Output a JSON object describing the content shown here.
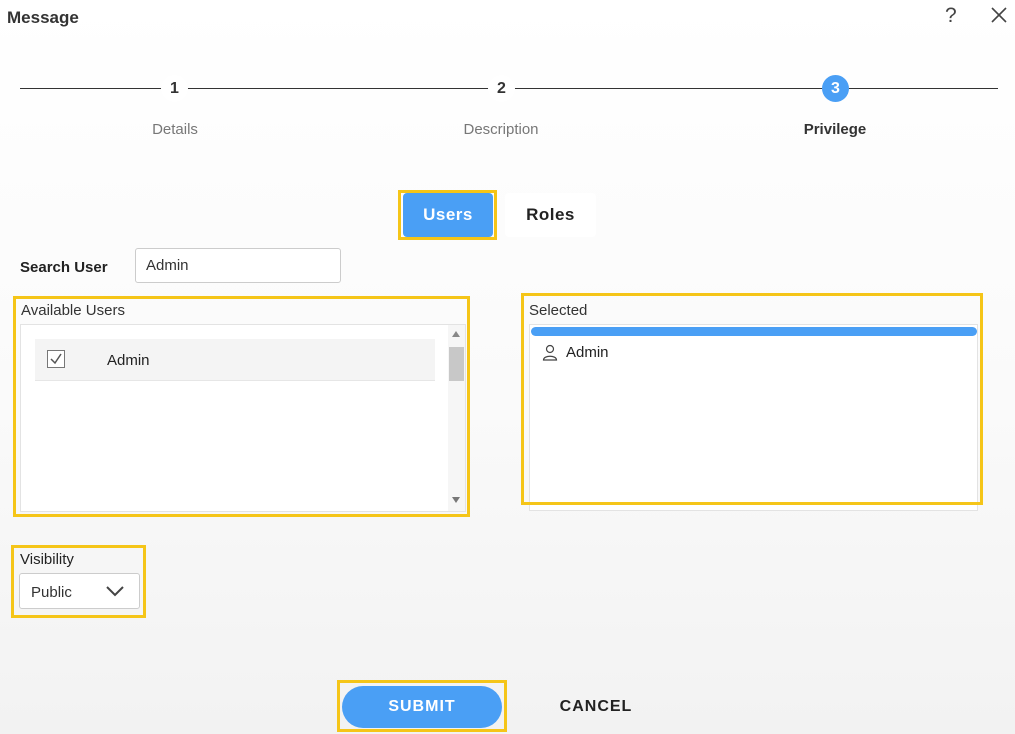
{
  "window": {
    "title": "Message"
  },
  "steps": [
    {
      "number": "1",
      "label": "Details"
    },
    {
      "number": "2",
      "label": "Description"
    },
    {
      "number": "3",
      "label": "Privilege"
    }
  ],
  "tabs": {
    "users": "Users",
    "roles": "Roles"
  },
  "search": {
    "label": "Search User",
    "value": "Admin"
  },
  "available": {
    "title": "Available Users",
    "items": [
      {
        "label": "Admin",
        "checked": true
      }
    ]
  },
  "selected": {
    "title": "Selected",
    "items": [
      {
        "label": "Admin"
      }
    ]
  },
  "visibility": {
    "label": "Visibility",
    "value": "Public"
  },
  "actions": {
    "submit": "SUBMIT",
    "cancel": "CANCEL"
  },
  "colors": {
    "accent": "#4a9ff5",
    "highlight": "#f5c518"
  },
  "icons": {
    "help": "help-icon",
    "close": "close-icon",
    "checkbox": "checkbox-icon",
    "user": "user-icon",
    "dropdown": "chevron-down-icon"
  }
}
